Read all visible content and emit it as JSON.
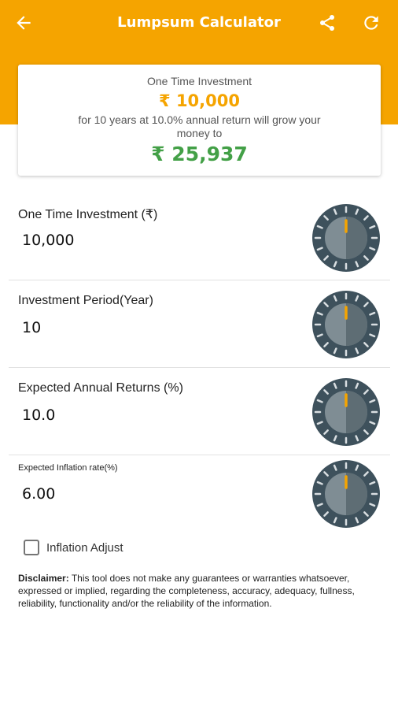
{
  "app_bar": {
    "title": "Lumpsum Calculator",
    "background": "#f5a400",
    "icons": [
      "back-arrow-icon",
      "share-icon",
      "refresh-icon"
    ]
  },
  "summary": {
    "label": "One Time Investment",
    "amount": "₹ 10,000",
    "description": "for 10 years at 10.0% annual return will grow your money to",
    "result": "₹ 25,937",
    "amount_color": "#f5a400",
    "result_color": "#43a047"
  },
  "inputs": [
    {
      "label": "One Time Investment (₹)",
      "value": "10,000"
    },
    {
      "label": "Investment Period(Year)",
      "value": "10"
    },
    {
      "label": "Expected Annual Returns (%)",
      "value": "10.0"
    },
    {
      "label": "Expected Inflation rate(%)",
      "value": "6.00"
    }
  ],
  "dial": {
    "icon": "rotary-dial-icon",
    "indicator_color": "#f5a400",
    "body_color": "#3e515c"
  },
  "inflation_adjust": {
    "label": "Inflation Adjust",
    "checked": false
  },
  "disclaimer": {
    "heading": "Disclaimer:",
    "text": " This tool does not make any guarantees or warranties whatsoever, expressed or implied, regarding the completeness, accuracy, adequacy, fullness, reliability, functionality and/or the reliability of the information."
  }
}
